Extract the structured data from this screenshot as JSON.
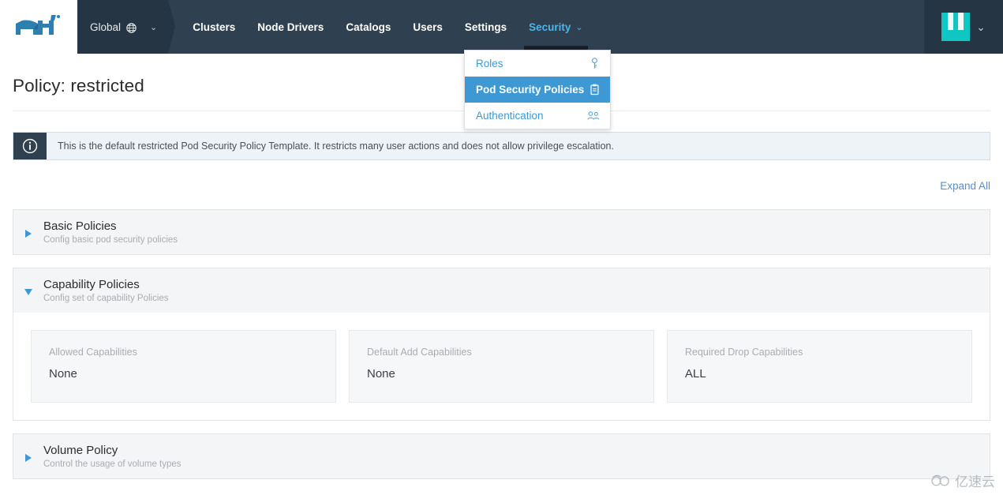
{
  "header": {
    "logo_name": "rancher-cow-logo",
    "cluster_picker": {
      "label": "Global",
      "icon": "globe-icon",
      "caret": "⌄"
    },
    "nav_items": [
      {
        "label": "Clusters",
        "active": false
      },
      {
        "label": "Node Drivers",
        "active": false
      },
      {
        "label": "Catalogs",
        "active": false
      },
      {
        "label": "Users",
        "active": false
      },
      {
        "label": "Settings",
        "active": false
      },
      {
        "label": "Security",
        "active": true,
        "caret": "⌄"
      }
    ],
    "user_menu": {
      "avatar_name": "user-avatar",
      "caret": "⌄"
    }
  },
  "dropdown": {
    "items": [
      {
        "label": "Roles",
        "icon": "key-icon",
        "selected": false
      },
      {
        "label": "Pod Security Policies",
        "icon": "clipboard-icon",
        "selected": true
      },
      {
        "label": "Authentication",
        "icon": "users-group-icon",
        "selected": false
      }
    ]
  },
  "page": {
    "title": "Policy: restricted",
    "banner": {
      "icon": "info-icon",
      "text": "This is the default restricted Pod Security Policy Template. It restricts many user actions and does not allow privilege escalation."
    },
    "expand_all": "Expand All",
    "sections": [
      {
        "title": "Basic Policies",
        "subtitle": "Config basic pod security policies",
        "expanded": false
      },
      {
        "title": "Capability Policies",
        "subtitle": "Config set of capability Policies",
        "expanded": true,
        "cards": [
          {
            "label": "Allowed Capabilities",
            "value": "None"
          },
          {
            "label": "Default Add Capabilities",
            "value": "None"
          },
          {
            "label": "Required Drop Capabilities",
            "value": "ALL"
          }
        ]
      },
      {
        "title": "Volume Policy",
        "subtitle": "Control the usage of volume types",
        "expanded": false
      }
    ]
  },
  "watermark": {
    "text": "亿速云"
  },
  "colors": {
    "navbar_bg": "#2f4050",
    "picker_bg": "#263544",
    "accent_blue": "#3d98d3",
    "link_blue": "#5b8ec4",
    "active_nav": "#4db5e8",
    "banner_bg": "#eef3f7",
    "section_header_bg": "#f4f5f6",
    "card_bg": "#f6f7f8",
    "avatar_teal": "#0fc6c2"
  }
}
